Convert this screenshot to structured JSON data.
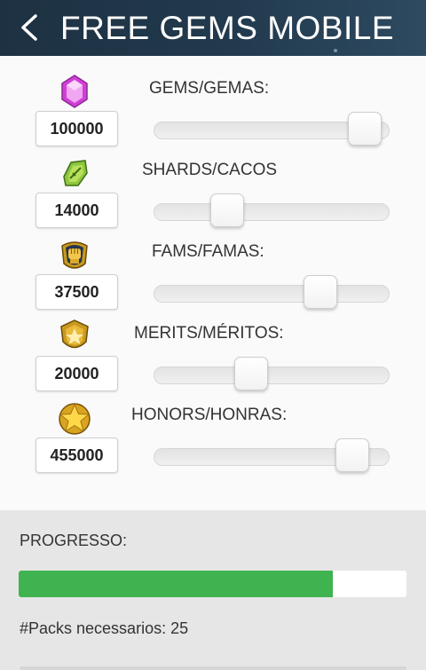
{
  "header": {
    "title": "FREE GEMS MOBILE",
    "background": "#1d3142"
  },
  "resources": [
    {
      "label": "GEMS/GEMAS:",
      "value": "100000",
      "slider_level": 0.96,
      "icon": "gem-icon"
    },
    {
      "label": "SHARDS/CACOS",
      "value": "14000",
      "slider_level": 0.28,
      "icon": "shard-icon"
    },
    {
      "label": "FAMS/FAMAS:",
      "value": "37500",
      "slider_level": 0.74,
      "icon": "fist-badge-icon"
    },
    {
      "label": "MERITS/MÉRITOS:",
      "value": "20000",
      "slider_level": 0.4,
      "icon": "shield-star-icon"
    },
    {
      "label": "HONORS/HONRAS:",
      "value": "455000",
      "slider_level": 0.9,
      "icon": "star-icon"
    }
  ],
  "progress": {
    "label": "PROGRESSO:",
    "level": 0.81,
    "fill_color": "#3fb34f",
    "packs_text": "#Packs necessarios: 25"
  }
}
